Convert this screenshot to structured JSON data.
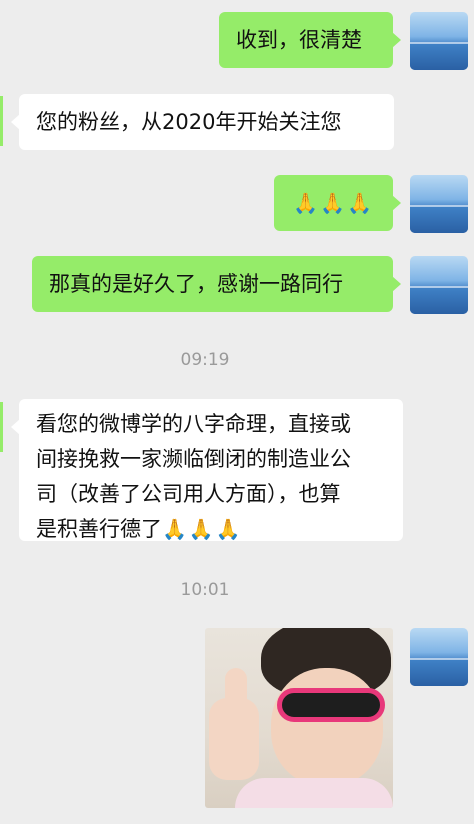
{
  "messages": [
    {
      "direction": "outgoing",
      "text": "收到，很清楚"
    },
    {
      "direction": "incoming",
      "text": "您的粉丝，从2020年开始关注您"
    },
    {
      "direction": "outgoing",
      "text": "🙏🙏🙏"
    },
    {
      "direction": "outgoing",
      "text": "那真的是好久了，感谢一路同行"
    },
    {
      "direction": "incoming",
      "lines": [
        "看您的微博学的八字命理，直接或",
        "间接挽救一家濒临倒闭的制造业公",
        "司（改善了公司用人方面），也算"
      ],
      "last_line": "是积善行德了",
      "last_emoji": "🙏🙏🙏"
    },
    {
      "direction": "outgoing",
      "type": "image"
    }
  ],
  "timestamps": [
    "09:19",
    "10:01"
  ],
  "colors": {
    "background": "#ededed",
    "outgoing_bubble": "#95ec69",
    "incoming_bubble": "#ffffff",
    "timestamp_text": "#9a9a9a"
  },
  "avatar_icon": "ocean-avatar-icon"
}
